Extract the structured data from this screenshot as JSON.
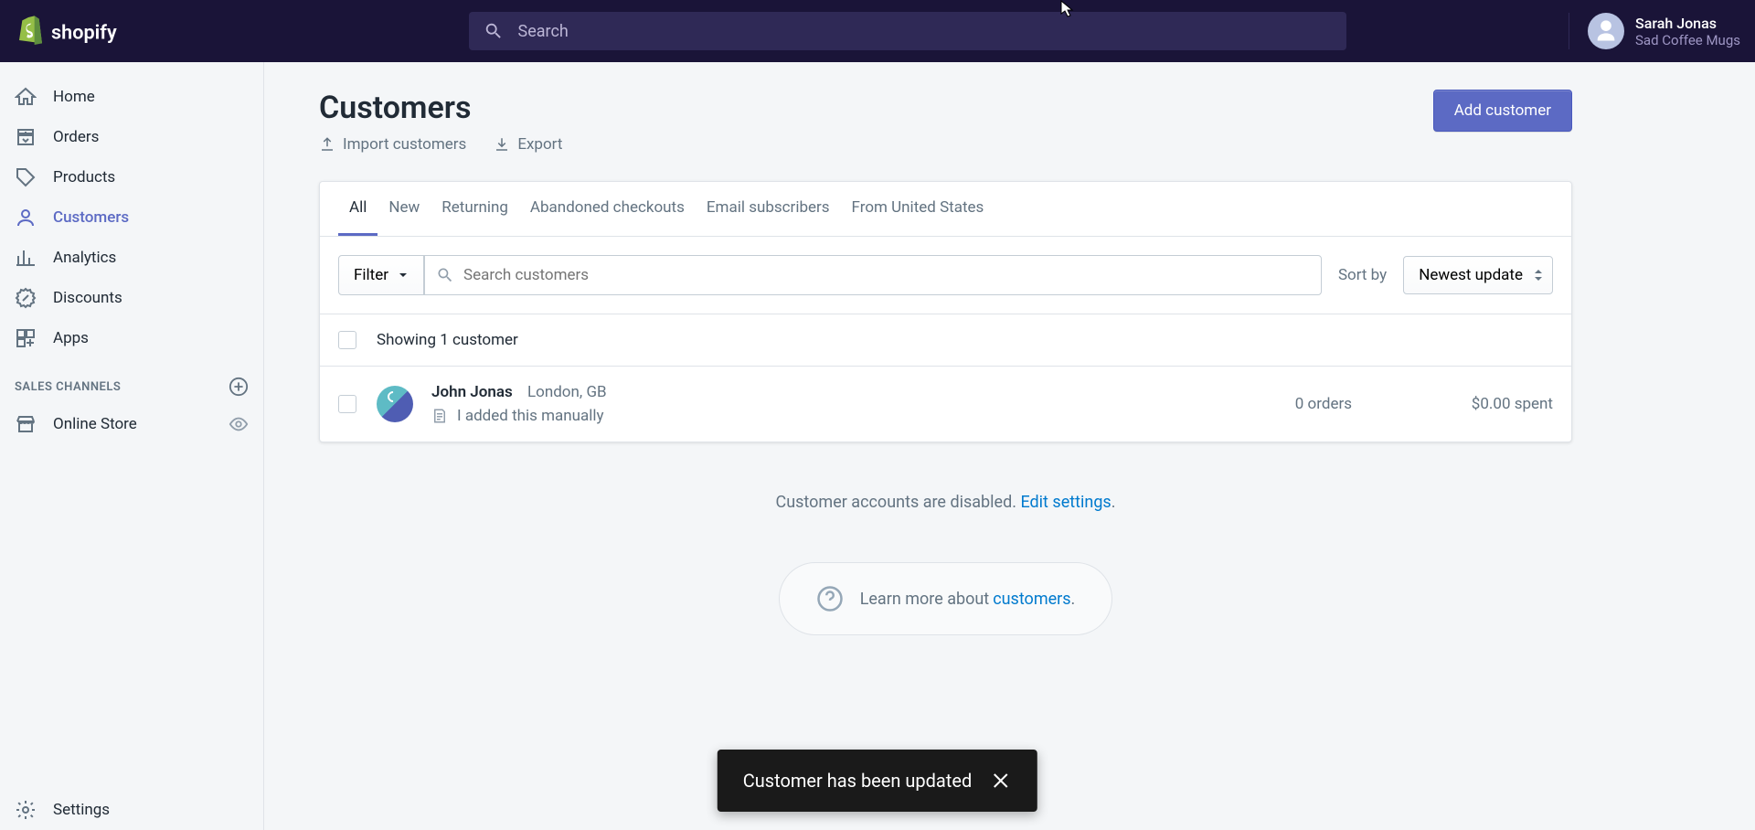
{
  "header": {
    "search_placeholder": "Search",
    "user_name": "Sarah Jonas",
    "store_name": "Sad Coffee Mugs"
  },
  "sidebar": {
    "items": [
      {
        "label": "Home"
      },
      {
        "label": "Orders"
      },
      {
        "label": "Products"
      },
      {
        "label": "Customers"
      },
      {
        "label": "Analytics"
      },
      {
        "label": "Discounts"
      },
      {
        "label": "Apps"
      }
    ],
    "section": "SALES CHANNELS",
    "channels": [
      {
        "label": "Online Store"
      }
    ],
    "settings": "Settings"
  },
  "page": {
    "title": "Customers",
    "import": "Import customers",
    "export": "Export",
    "add_button": "Add customer"
  },
  "tabs": [
    "All",
    "New",
    "Returning",
    "Abandoned checkouts",
    "Email subscribers",
    "From United States"
  ],
  "filter": {
    "button": "Filter",
    "search_placeholder": "Search customers",
    "sort_label": "Sort by",
    "sort_value": "Newest update"
  },
  "list": {
    "count": "Showing 1 customer",
    "rows": [
      {
        "name": "John Jonas",
        "location": "London, GB",
        "note": "I added this manually",
        "orders": "0 orders",
        "spent": "$0.00 spent"
      }
    ]
  },
  "footer": {
    "disabled_prefix": "Customer accounts are disabled. ",
    "edit_link": "Edit settings",
    "disabled_suffix": ".",
    "learn_prefix": "Learn more about ",
    "learn_link": "customers",
    "learn_suffix": "."
  },
  "toast": "Customer has been updated"
}
